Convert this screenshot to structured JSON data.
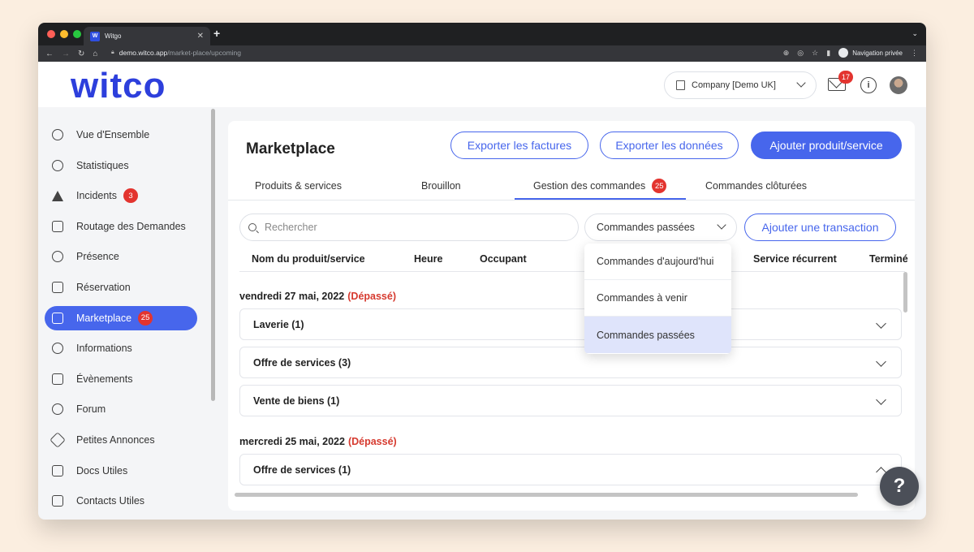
{
  "browser": {
    "tab_title": "Witgo",
    "favicon_letter": "W",
    "url_host": "demo.witco.app",
    "url_path": "/market-place/upcoming",
    "private_label": "Navigation privée"
  },
  "header": {
    "logo": "witco",
    "company": "Company [Demo UK]",
    "mail_count": "17"
  },
  "sidebar": {
    "items": [
      {
        "label": "Vue d'Ensemble",
        "icon": "eye-icon"
      },
      {
        "label": "Statistiques",
        "icon": "pie-chart-icon"
      },
      {
        "label": "Incidents",
        "icon": "warning-icon",
        "badge": "3"
      },
      {
        "label": "Routage des Demandes",
        "icon": "routing-icon"
      },
      {
        "label": "Présence",
        "icon": "check-circle-icon"
      },
      {
        "label": "Réservation",
        "icon": "calendar-icon"
      },
      {
        "label": "Marketplace",
        "icon": "shop-icon",
        "badge": "25",
        "active": true
      },
      {
        "label": "Informations",
        "icon": "info-icon"
      },
      {
        "label": "Évènements",
        "icon": "event-calendar-icon"
      },
      {
        "label": "Forum",
        "icon": "chat-bubble-icon"
      },
      {
        "label": "Petites Annonces",
        "icon": "tag-icon"
      },
      {
        "label": "Docs Utiles",
        "icon": "document-icon"
      },
      {
        "label": "Contacts Utiles",
        "icon": "phone-icon"
      }
    ]
  },
  "main": {
    "title": "Marketplace",
    "buttons": {
      "export_invoices": "Exporter les factures",
      "export_data": "Exporter les données",
      "add_product": "Ajouter produit/service"
    },
    "tabs": [
      {
        "label": "Produits & services"
      },
      {
        "label": "Brouillon"
      },
      {
        "label": "Gestion des commandes",
        "badge": "25"
      },
      {
        "label": "Commandes clôturées"
      }
    ],
    "search_placeholder": "Rechercher",
    "filter_value": "Commandes passées",
    "add_transaction": "Ajouter une transaction",
    "columns": [
      "Nom du produit/service",
      "Heure",
      "Occupant",
      "Service récurrent",
      "Terminé"
    ],
    "groups": [
      {
        "date": "vendredi 27 mai, 2022",
        "status": "(Dépassé)",
        "rows": [
          "Laverie (1)",
          "Offre de services (3)",
          "Vente de biens (1)"
        ]
      },
      {
        "date": "mercredi 25 mai, 2022",
        "status": "(Dépassé)",
        "rows": [
          "Offre de services (1)"
        ]
      }
    ]
  },
  "dropdown": {
    "options": [
      "Commandes d'aujourd'hui",
      "Commandes à venir",
      "Commandes passées"
    ],
    "selected": "Commandes passées"
  },
  "help_label": "?",
  "colors": {
    "accent": "#4766ec",
    "badge": "#e3342f",
    "late": "#d63a2f",
    "logo": "#2d3fdc"
  }
}
